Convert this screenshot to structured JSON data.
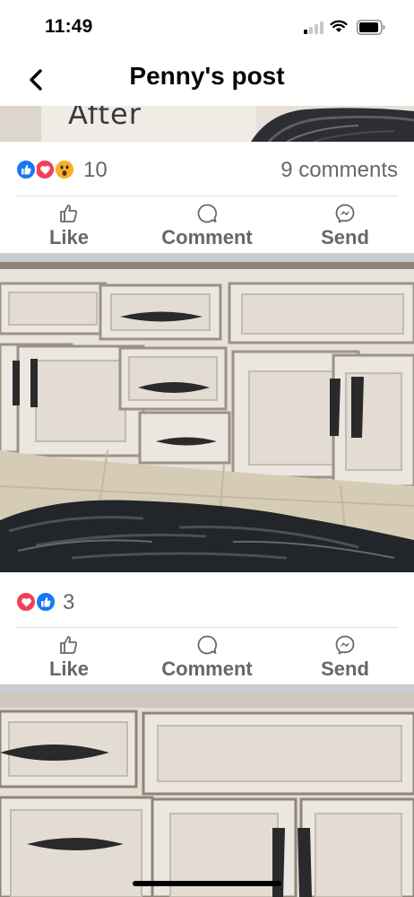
{
  "status_bar": {
    "time": "11:49"
  },
  "header": {
    "title": "Penny's post"
  },
  "posts": [
    {
      "image_text": "After",
      "reaction_count": "10",
      "comments": "9 comments",
      "reactions": [
        "like-icon",
        "love-icon",
        "wow-icon"
      ]
    },
    {
      "reaction_count": "3",
      "reactions": [
        "love-icon",
        "like-icon"
      ]
    }
  ],
  "actions": {
    "like": "Like",
    "comment": "Comment",
    "send": "Send"
  },
  "colors": {
    "like_blue": "#1877f2",
    "love_red": "#f33e58",
    "wow_yellow": "#f7b125",
    "text_gray": "#65676b"
  }
}
